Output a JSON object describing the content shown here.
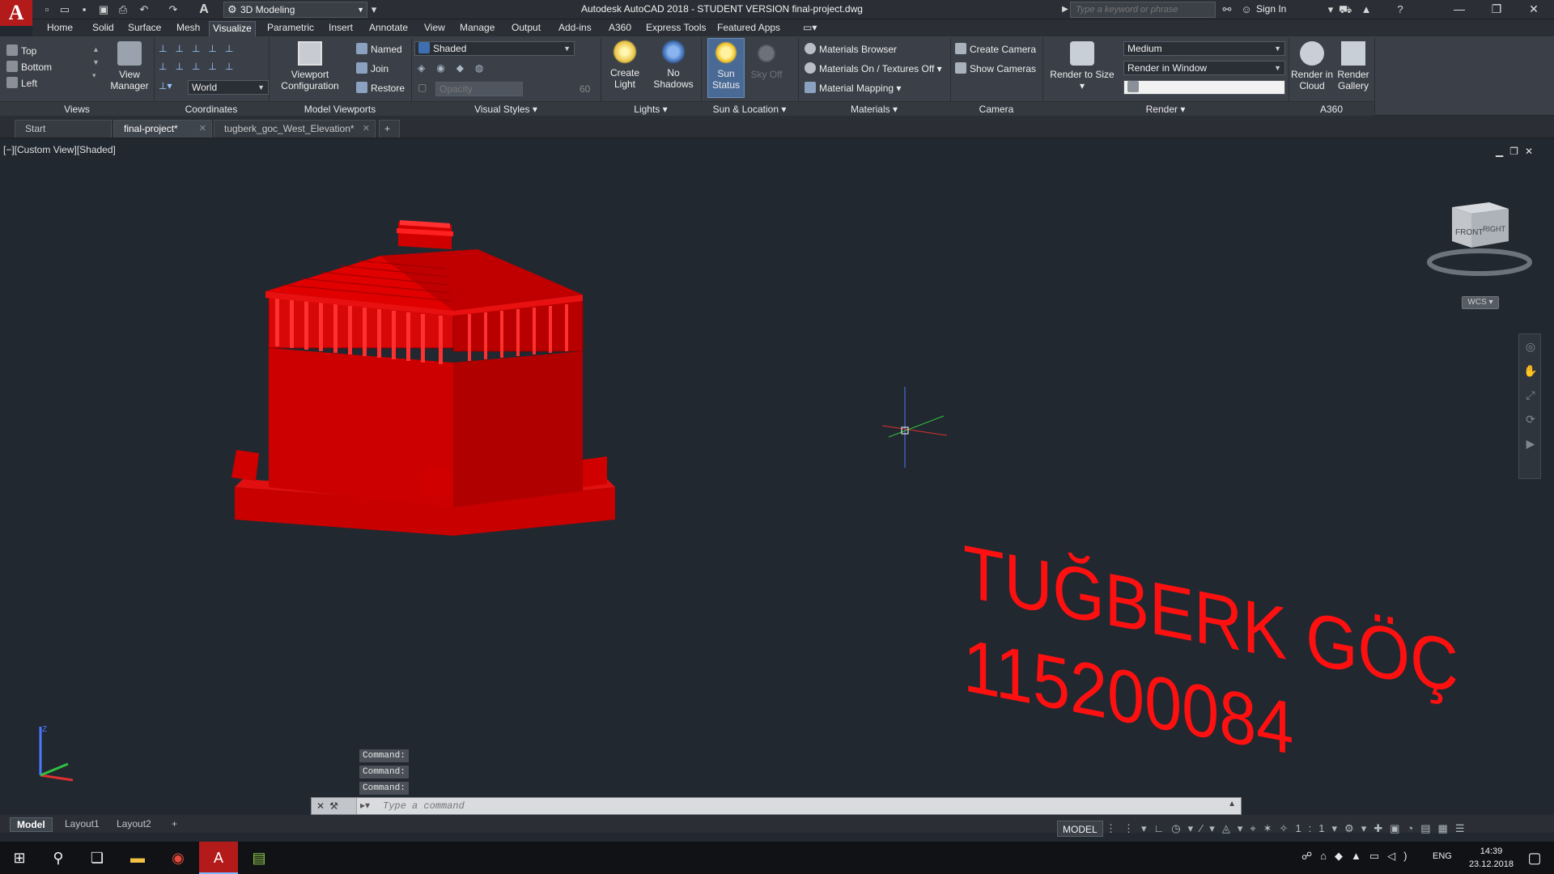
{
  "titlebar": {
    "app_logo": "A",
    "workspace": "3D Modeling",
    "title": "Autodesk AutoCAD 2018 - STUDENT VERSION    final-project.dwg",
    "search_placeholder": "Type a keyword or phrase",
    "signin": "Sign In"
  },
  "ribbon_tabs": [
    "Home",
    "Solid",
    "Surface",
    "Mesh",
    "Visualize",
    "Parametric",
    "Insert",
    "Annotate",
    "View",
    "Manage",
    "Output",
    "Add-ins",
    "A360",
    "Express Tools",
    "Featured Apps"
  ],
  "active_ribbon_tab": "Visualize",
  "ribbon": {
    "views": {
      "title": "Views",
      "items": [
        "Top",
        "Bottom",
        "Left"
      ],
      "view_manager": "View\nManager"
    },
    "coordinates": {
      "title": "Coordinates",
      "ucs": "World"
    },
    "model_viewports": {
      "title": "Model Viewports",
      "config": "Viewport\nConfiguration",
      "named": "Named",
      "join": "Join",
      "restore": "Restore"
    },
    "visual_styles": {
      "title": "Visual Styles",
      "style": "Shaded",
      "opacity_placeholder": "Opacity",
      "opacity_value": "60"
    },
    "lights": {
      "title": "Lights",
      "create_light": "Create\nLight",
      "no_shadows": "No\nShadows"
    },
    "sun_location": {
      "title": "Sun & Location",
      "sun_status": "Sun\nStatus",
      "sky_off": "Sky Off"
    },
    "materials": {
      "title": "Materials",
      "browser": "Materials Browser",
      "on_textures": "Materials On / Textures Off",
      "mapping": "Material Mapping"
    },
    "camera": {
      "title": "Camera",
      "create": "Create Camera",
      "show": "Show  Cameras"
    },
    "render": {
      "title": "Render",
      "render_to_size": "Render to Size",
      "quality": "Medium",
      "destination": "Render in Window"
    },
    "a360": {
      "title": "A360",
      "cloud": "Render in\nCloud",
      "gallery": "Render\nGallery"
    }
  },
  "doc_tabs": [
    {
      "label": "Start",
      "active": false
    },
    {
      "label": "final-project*",
      "active": true
    },
    {
      "label": "tugberk_goc_West_Elevation*",
      "active": false
    }
  ],
  "viewport": {
    "label": "[−][Custom View][Shaded]",
    "name_text": "TUĞBERK GÖÇ",
    "id_text": "115200084",
    "viewcube_front": "FRONT",
    "viewcube_right": "RIGHT",
    "wcs": "WCS",
    "colors": {
      "model": "#d40000",
      "text": "#ff1010",
      "background": "#212830"
    }
  },
  "command_history": [
    "Command:",
    "Command:",
    "Command:"
  ],
  "command_placeholder": "Type a command",
  "layout_tabs": [
    {
      "label": "Model",
      "active": true
    },
    {
      "label": "Layout1",
      "active": false
    },
    {
      "label": "Layout2",
      "active": false
    }
  ],
  "statusbar": {
    "model": "MODEL",
    "scale": "1:1"
  },
  "taskbar": {
    "lang": "ENG",
    "time": "14:39",
    "date": "23.12.2018"
  }
}
